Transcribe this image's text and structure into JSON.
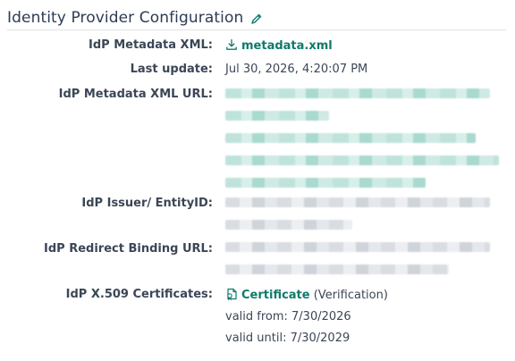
{
  "header": {
    "title": "Identity Provider Configuration",
    "edit_icon": "pencil-icon"
  },
  "fields": {
    "metadata_xml": {
      "label": "IdP Metadata XML:",
      "link_text": "metadata.xml",
      "icon": "download-icon"
    },
    "last_update": {
      "label": "Last update:",
      "value": "Jul 30, 2026, 4:20:07 PM"
    },
    "metadata_url": {
      "label": "IdP Metadata XML URL:"
    },
    "issuer": {
      "label": "IdP Issuer/ EntityID:"
    },
    "redirect_binding": {
      "label": "IdP Redirect Binding URL:"
    },
    "certificates": {
      "label": "IdP X.509 Certificates:",
      "link_text": "Certificate",
      "type_note": "(Verification)",
      "valid_from": "valid from: 7/30/2026",
      "valid_until": "valid until: 7/30/2029",
      "icon": "certificate-icon"
    }
  },
  "colors": {
    "link": "#0f7a6a",
    "text": "#3b4656",
    "title": "#2d3b53"
  }
}
